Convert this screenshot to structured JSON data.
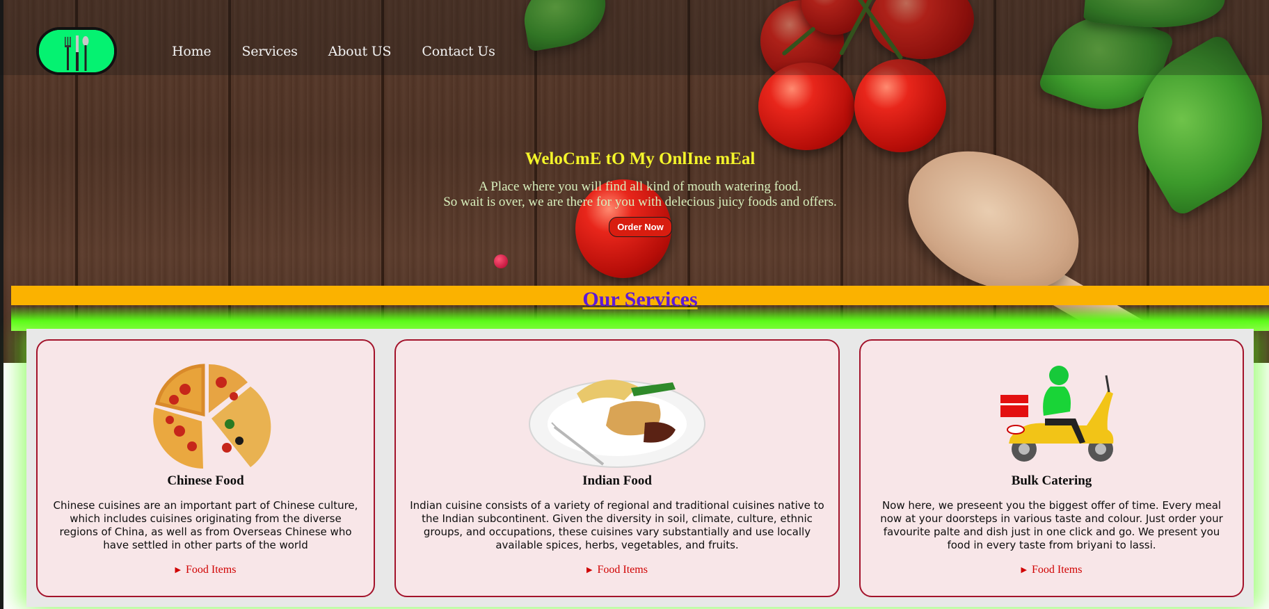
{
  "nav": {
    "logo_name": "fork-knife-spoon-icon",
    "links": [
      "Home",
      "Services",
      "About US",
      "Contact Us"
    ]
  },
  "hero": {
    "headline": "WeloCmE tO My OnlIne mEal",
    "tagline_line1": "A Place where you will find all kind of mouth watering food.",
    "tagline_line2": "So wait is over, we are there for you with delecious juicy foods and offers.",
    "order_button": "Order Now"
  },
  "services": {
    "heading": "Our Services",
    "cards": [
      {
        "title": "Chinese Food",
        "image": "pizza-slices-image",
        "description": "Chinese cuisines are an important part of Chinese culture, which includes cuisines originating from the diverse regions of China, as well as from Overseas Chinese who have settled in other parts of the world",
        "link": "Food Items"
      },
      {
        "title": "Indian Food",
        "image": "plated-meal-image",
        "description": "Indian cuisine consists of a variety of regional and traditional cuisines native to the Indian subcontinent. Given the diversity in soil, climate, culture, ethnic groups, and occupations, these cuisines vary substantially and use locally available spices, herbs, vegetables, and fruits.",
        "link": "Food Items"
      },
      {
        "title": "Bulk Catering",
        "image": "delivery-scooter-image",
        "description": "Now here, we preseent you the biggest offer of time. Every meal now at your doorsteps in various taste and colour. Just order your favourite palte and dish just in one click and go. We present you food in every taste from briyani to lassi.",
        "link": "Food Items"
      }
    ]
  },
  "colors": {
    "accent_yellow": "#fbb200",
    "heading_purple": "#5d1ad6",
    "headline_yellow": "#f4f52a",
    "button_red": "#d81d10",
    "card_border": "#a3132b",
    "card_bg": "#f8e6e8",
    "glow_green": "#5dfb1a",
    "logo_green": "#05f271"
  }
}
